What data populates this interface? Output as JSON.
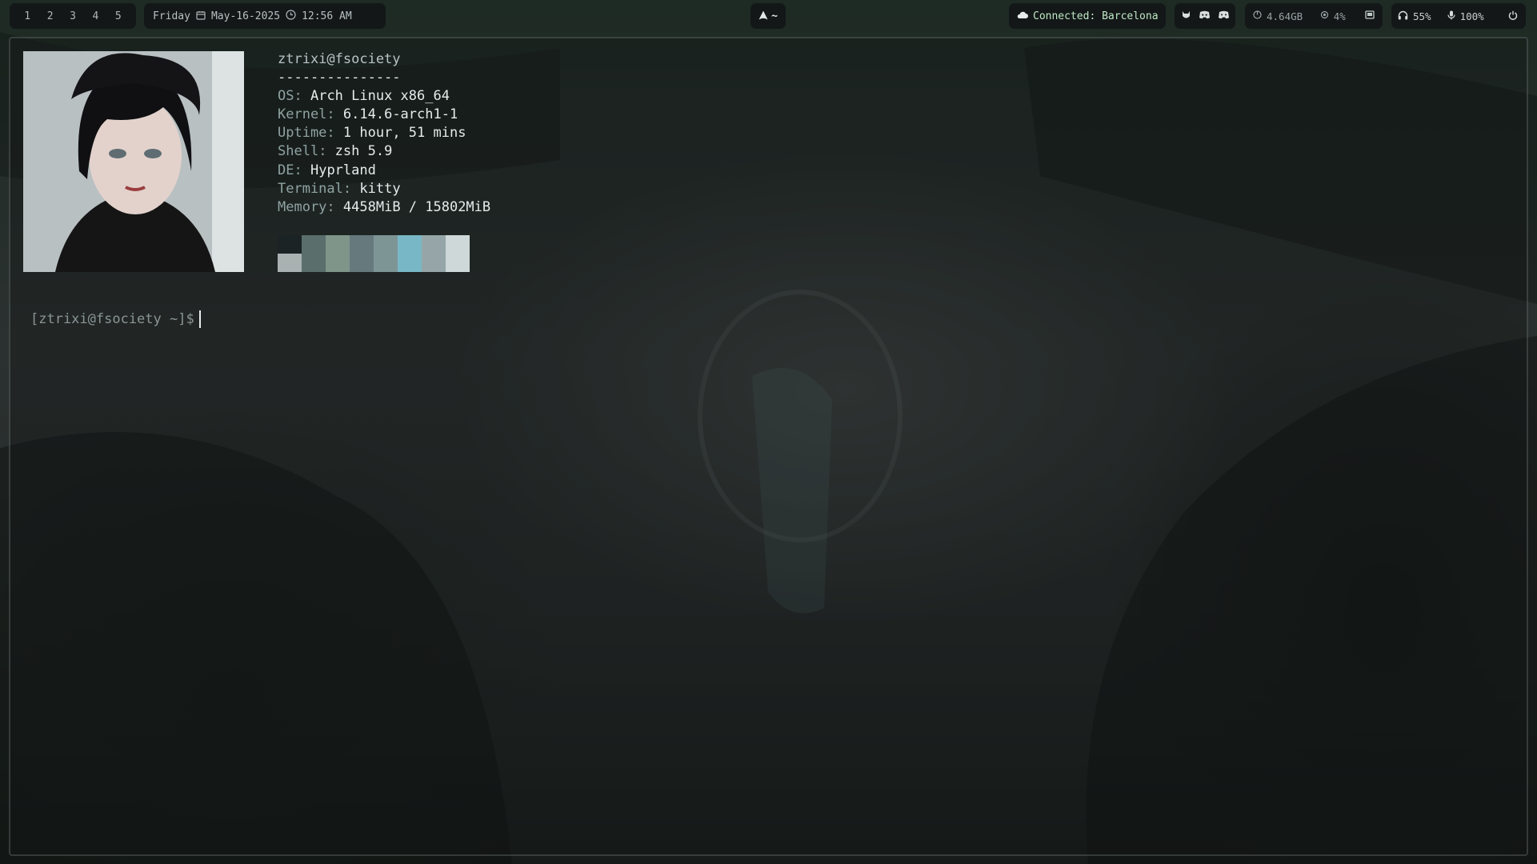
{
  "topbar": {
    "workspaces": [
      "1",
      "2",
      "3",
      "4",
      "5"
    ],
    "day": "Friday",
    "date": "May-16-2025",
    "time": "12:56 AM",
    "arch_label": "~",
    "vpn": "Connected: Barcelona",
    "app_icons": [
      "cat-icon",
      "discord-icon",
      "gamepad-icon"
    ],
    "disk_free": "4.64GB",
    "cpu": "4%",
    "headphones_volume": "55%",
    "mic_volume": "100%"
  },
  "terminal": {
    "user_host": "ztrixi@fsociety",
    "separator": "---------------",
    "info": [
      {
        "key": "OS",
        "value": "Arch Linux x86_64"
      },
      {
        "key": "Kernel",
        "value": "6.14.6-arch1-1"
      },
      {
        "key": "Uptime",
        "value": "1 hour, 51 mins"
      },
      {
        "key": "Shell",
        "value": "zsh 5.9"
      },
      {
        "key": "DE",
        "value": "Hyprland"
      },
      {
        "key": "Terminal",
        "value": "kitty"
      },
      {
        "key": "Memory",
        "value": "4458MiB / 15802MiB"
      }
    ],
    "palette": [
      "#1c2324",
      "#5a6e6c",
      "#7f958a",
      "#667a7e",
      "#7e9596",
      "#78b8c6",
      "#96a6a8",
      "#cfd8d8"
    ],
    "palette_first_bottom": "#a9b1b1",
    "prompt": "[ztrixi@fsociety ~]$"
  }
}
